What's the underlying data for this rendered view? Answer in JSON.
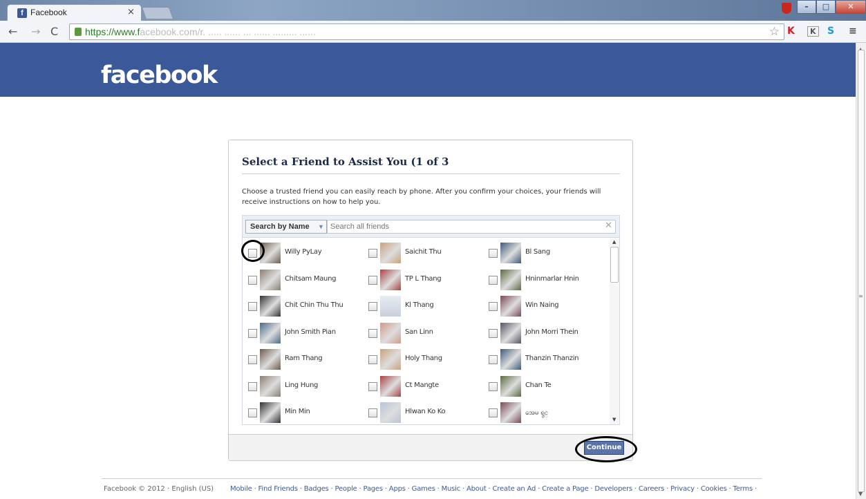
{
  "browser": {
    "tab_title": "Facebook",
    "tab_close": "×",
    "url_main": "https://www.f",
    "url_rest": "acebook.com/r.  ..... ......  ... ...... ......... ......",
    "win_min": "–",
    "win_max": "□",
    "win_close": "✕"
  },
  "header": {
    "logo": "facebook"
  },
  "dialog": {
    "title": "Select a Friend to Assist You (1 of 3",
    "description": "Choose a trusted friend you can easily reach by phone. After you confirm your choices, your friends will receive instructions on how to help you.",
    "search_by_label": "Search by Name",
    "search_placeholder": "Search all friends",
    "continue_label": "Continue"
  },
  "friends": [
    [
      "Willy PyLay",
      "Saichit Thu",
      "Bl Sang"
    ],
    [
      "Chitsam Maung",
      "TP L Thang",
      "Hninmarlar Hnin"
    ],
    [
      "Chit Chin Thu Thu",
      "Kl Thang",
      "Win Naing"
    ],
    [
      "John Smith Pian",
      "San Linn",
      "John Morri Thein"
    ],
    [
      "Ram Thang",
      "Holy Thang",
      "Thanzin Thanzin"
    ],
    [
      "Ling Hung",
      "Ct Mangte",
      "Chan Te"
    ],
    [
      "Min Min",
      "Hlwan Ko Ko",
      "အေမ ရွင္"
    ]
  ],
  "footer": {
    "copyright": "Facebook © 2012 · English (US)",
    "links": "Mobile · Find Friends · Badges · People · Pages · Apps · Games · Music · About · Create an Ad · Create a Page · Developers · Careers · Privacy · Cookies · Terms ·"
  }
}
